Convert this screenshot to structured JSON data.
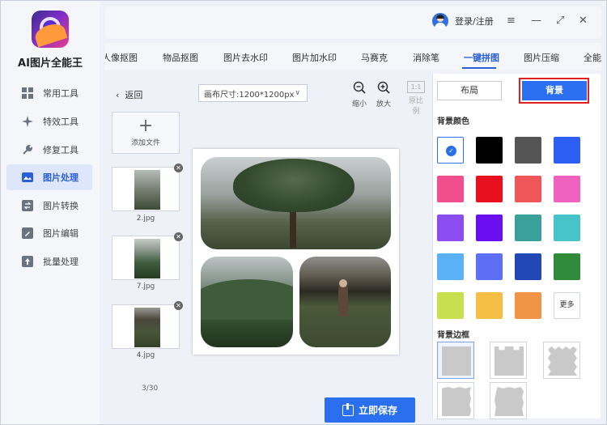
{
  "app": {
    "title": "AI图片全能王"
  },
  "sidebar": {
    "items": [
      {
        "label": "常用工具",
        "icon": "grid-icon",
        "active": false
      },
      {
        "label": "特效工具",
        "icon": "sparkle-icon",
        "active": false
      },
      {
        "label": "修复工具",
        "icon": "wrench-icon",
        "active": false
      },
      {
        "label": "图片处理",
        "icon": "image-icon",
        "active": true
      },
      {
        "label": "图片转换",
        "icon": "convert-icon",
        "active": false
      },
      {
        "label": "图片编辑",
        "icon": "edit-icon",
        "active": false
      },
      {
        "label": "批量处理",
        "icon": "upload-icon",
        "active": false
      }
    ]
  },
  "topbar": {
    "login_label": "登录/注册",
    "menu_icon": "≡",
    "minimize_icon": "—",
    "maximize_icon": "⤢",
    "close_icon": "✕"
  },
  "tabs": {
    "items": [
      "人像抠图",
      "物品抠图",
      "图片去水印",
      "图片加水印",
      "马赛克",
      "消除笔",
      "一键拼图",
      "图片压缩",
      "全能"
    ],
    "active": "一键拼图"
  },
  "toolbar": {
    "back_label": "返回",
    "canvas_size_label": "画布尺寸:1200*1200px",
    "zoom_out_label": "缩小",
    "zoom_in_label": "放大",
    "ratio_button_label": "1:1",
    "ratio_label": "原比例"
  },
  "files": {
    "add_label": "添加文件",
    "items": [
      {
        "name": "2.jpg"
      },
      {
        "name": "7.jpg"
      },
      {
        "name": "4.jpg"
      }
    ],
    "counter": "3/30"
  },
  "right_panel": {
    "layout_tab": "布局",
    "background_tab": "背景",
    "background_color_title": "背景颜色",
    "colors": [
      "#ffffff",
      "#000000",
      "#555555",
      "#2d5ff5",
      "#f04e8c",
      "#e8101f",
      "#ef5659",
      "#f062c0",
      "#8b4cf0",
      "#6a10f0",
      "#3aa09a",
      "#46c4c9",
      "#5ab2f5",
      "#5c6ff5",
      "#2248b5",
      "#2f8a3a",
      "#c8e050",
      "#f5bf45",
      "#f09545"
    ],
    "selected_color": "#ffffff",
    "more_label": "更多",
    "border_title": "背景边框"
  },
  "footer": {
    "save_label": "立即保存"
  },
  "colors": {
    "accent": "#2a6ff0",
    "highlight": "#e02020",
    "sidebar_active_bg": "#dde6fb"
  }
}
